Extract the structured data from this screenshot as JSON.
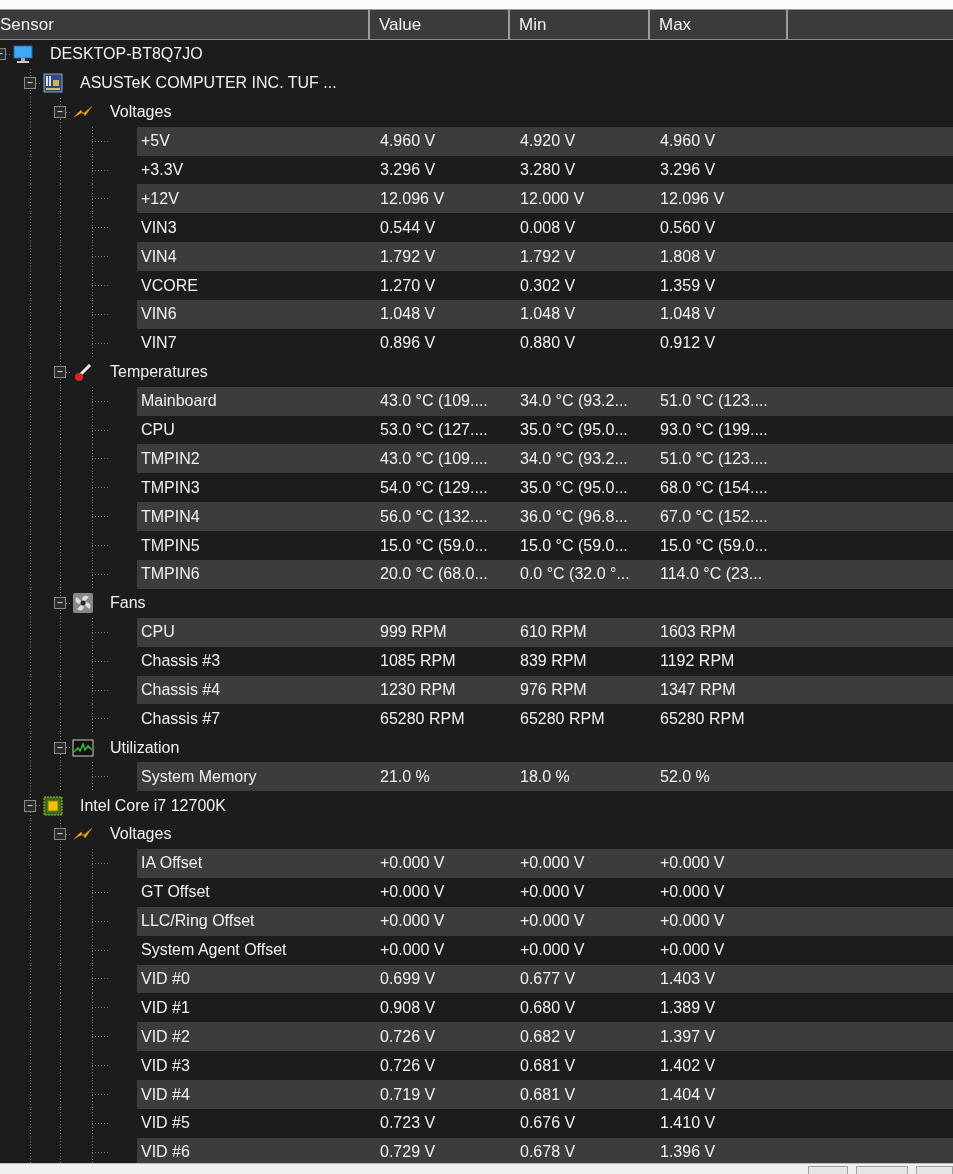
{
  "columns": [
    "Sensor",
    "Value",
    "Min",
    "Max"
  ],
  "tree": {
    "name": "DESKTOP-BT8Q7JO",
    "kind": "computer",
    "expanded": true,
    "children": [
      {
        "name": "ASUSTeK COMPUTER INC. TUF ...",
        "kind": "motherboard",
        "expanded": true,
        "children": [
          {
            "name": "Voltages",
            "kind": "voltage",
            "expanded": true,
            "sensors": [
              {
                "name": "+5V",
                "value": "4.960 V",
                "min": "4.920 V",
                "max": "4.960 V"
              },
              {
                "name": "+3.3V",
                "value": "3.296 V",
                "min": "3.280 V",
                "max": "3.296 V"
              },
              {
                "name": "+12V",
                "value": "12.096 V",
                "min": "12.000 V",
                "max": "12.096 V"
              },
              {
                "name": "VIN3",
                "value": "0.544 V",
                "min": "0.008 V",
                "max": "0.560 V"
              },
              {
                "name": "VIN4",
                "value": "1.792 V",
                "min": "1.792 V",
                "max": "1.808 V"
              },
              {
                "name": "VCORE",
                "value": "1.270 V",
                "min": "0.302 V",
                "max": "1.359 V"
              },
              {
                "name": "VIN6",
                "value": "1.048 V",
                "min": "1.048 V",
                "max": "1.048 V"
              },
              {
                "name": "VIN7",
                "value": "0.896 V",
                "min": "0.880 V",
                "max": "0.912 V"
              }
            ]
          },
          {
            "name": "Temperatures",
            "kind": "temperature",
            "expanded": true,
            "sensors": [
              {
                "name": "Mainboard",
                "value": "43.0 °C (109....",
                "min": "34.0 °C (93.2...",
                "max": "51.0 °C (123...."
              },
              {
                "name": "CPU",
                "value": "53.0 °C (127....",
                "min": "35.0 °C (95.0...",
                "max": "93.0 °C (199...."
              },
              {
                "name": "TMPIN2",
                "value": "43.0 °C (109....",
                "min": "34.0 °C (93.2...",
                "max": "51.0 °C (123...."
              },
              {
                "name": "TMPIN3",
                "value": "54.0 °C (129....",
                "min": "35.0 °C (95.0...",
                "max": "68.0 °C (154...."
              },
              {
                "name": "TMPIN4",
                "value": "56.0 °C (132....",
                "min": "36.0 °C (96.8...",
                "max": "67.0 °C (152...."
              },
              {
                "name": "TMPIN5",
                "value": "15.0 °C (59.0...",
                "min": "15.0 °C (59.0...",
                "max": "15.0 °C (59.0..."
              },
              {
                "name": "TMPIN6",
                "value": "20.0 °C (68.0...",
                "min": "0.0 °C (32.0 °...",
                "max": "114.0 °C (23..."
              }
            ]
          },
          {
            "name": "Fans",
            "kind": "fan",
            "expanded": true,
            "sensors": [
              {
                "name": "CPU",
                "value": "999 RPM",
                "min": "610 RPM",
                "max": "1603 RPM"
              },
              {
                "name": "Chassis #3",
                "value": "1085 RPM",
                "min": "839 RPM",
                "max": "1192 RPM"
              },
              {
                "name": "Chassis #4",
                "value": "1230 RPM",
                "min": "976 RPM",
                "max": "1347 RPM"
              },
              {
                "name": "Chassis #7",
                "value": "65280 RPM",
                "min": "65280 RPM",
                "max": "65280 RPM"
              }
            ]
          },
          {
            "name": "Utilization",
            "kind": "utilization",
            "expanded": true,
            "sensors": [
              {
                "name": "System Memory",
                "value": "21.0 %",
                "min": "18.0 %",
                "max": "52.0 %"
              }
            ]
          }
        ]
      },
      {
        "name": "Intel Core i7 12700K",
        "kind": "cpu",
        "expanded": true,
        "children": [
          {
            "name": "Voltages",
            "kind": "voltage",
            "expanded": true,
            "sensors": [
              {
                "name": "IA Offset",
                "value": "+0.000 V",
                "min": "+0.000 V",
                "max": "+0.000 V"
              },
              {
                "name": "GT Offset",
                "value": "+0.000 V",
                "min": "+0.000 V",
                "max": "+0.000 V"
              },
              {
                "name": "LLC/Ring Offset",
                "value": "+0.000 V",
                "min": "+0.000 V",
                "max": "+0.000 V"
              },
              {
                "name": "System Agent Offset",
                "value": "+0.000 V",
                "min": "+0.000 V",
                "max": "+0.000 V"
              },
              {
                "name": "VID #0",
                "value": "0.699 V",
                "min": "0.677 V",
                "max": "1.403 V"
              },
              {
                "name": "VID #1",
                "value": "0.908 V",
                "min": "0.680 V",
                "max": "1.389 V"
              },
              {
                "name": "VID #2",
                "value": "0.726 V",
                "min": "0.682 V",
                "max": "1.397 V"
              },
              {
                "name": "VID #3",
                "value": "0.726 V",
                "min": "0.681 V",
                "max": "1.402 V"
              },
              {
                "name": "VID #4",
                "value": "0.719 V",
                "min": "0.681 V",
                "max": "1.404 V"
              },
              {
                "name": "VID #5",
                "value": "0.723 V",
                "min": "0.676 V",
                "max": "1.410 V"
              },
              {
                "name": "VID #6",
                "value": "0.729 V",
                "min": "0.678 V",
                "max": "1.396 V"
              }
            ]
          }
        ]
      }
    ]
  }
}
